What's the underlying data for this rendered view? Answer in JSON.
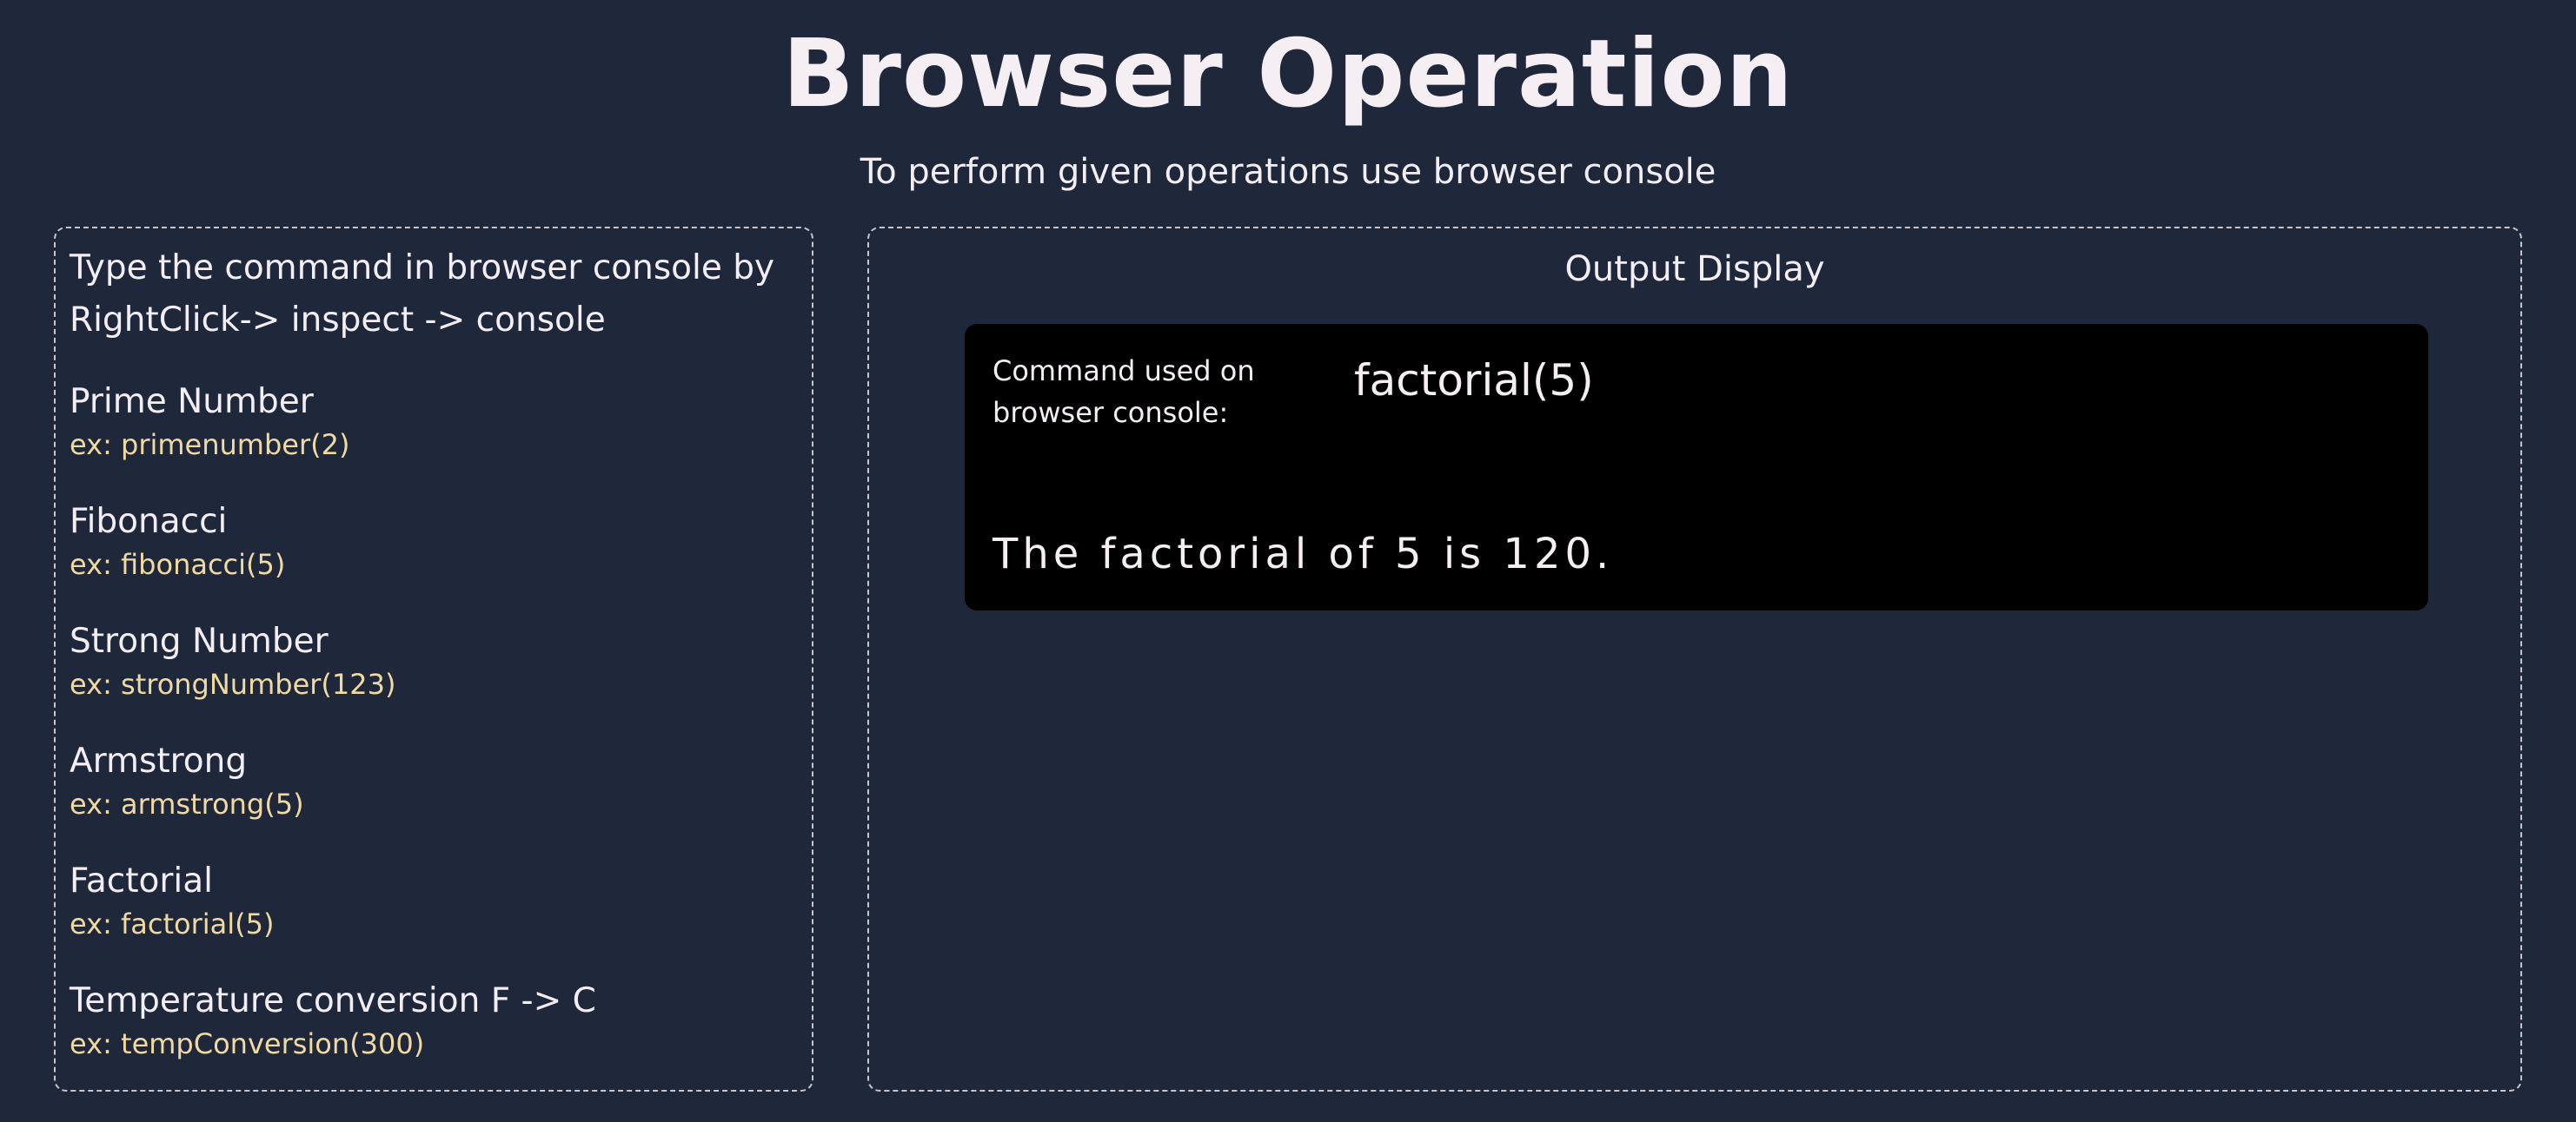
{
  "header": {
    "title": "Browser Operation",
    "subtitle": "To perform given operations use browser console"
  },
  "instructions_panel": {
    "instructions": "Type the command in browser console by RightClick-> inspect -> console",
    "operations": [
      {
        "name": "Prime Number",
        "example": "ex: primenumber(2)"
      },
      {
        "name": "Fibonacci",
        "example": "ex: fibonacci(5)"
      },
      {
        "name": "Strong Number",
        "example": "ex: strongNumber(123)"
      },
      {
        "name": "Armstrong",
        "example": "ex: armstrong(5)"
      },
      {
        "name": "Factorial",
        "example": "ex: factorial(5)"
      },
      {
        "name": "Temperature conversion F -> C",
        "example": "ex: tempConversion(300)"
      }
    ]
  },
  "output_panel": {
    "title": "Output Display",
    "command_label": "Command used on browser console:",
    "command_value": "factorial(5)",
    "result": "The factorial of 5 is 120."
  },
  "colors": {
    "background": "#1f283b",
    "text": "#f2eef3",
    "example_text": "#f1d9a2",
    "console_background": "#000000",
    "panel_border": "#c9c5cc"
  }
}
